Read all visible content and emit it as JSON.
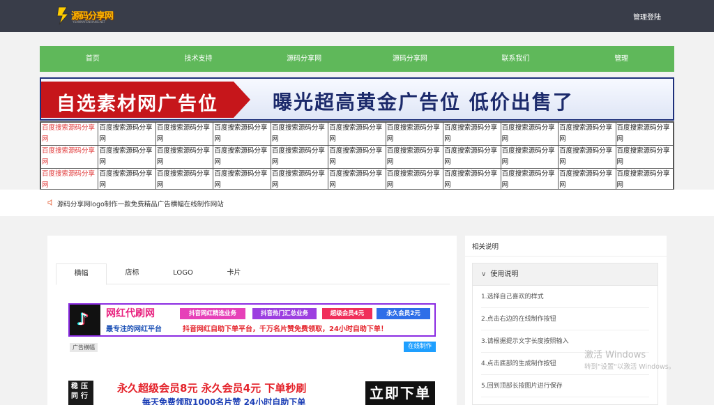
{
  "header": {
    "logo_text": "源码分享网",
    "logo_sub": "YUANMAFENXIANG.NET",
    "admin_login": "管理登陆"
  },
  "nav": [
    "首页",
    "技术支持",
    "源码分享网",
    "源码分享网",
    "联系我们",
    "管理"
  ],
  "banner": {
    "left_text": "自选素材网广告位",
    "right_text": "曝光超高黄金广告位 低价出售了"
  },
  "link_grid": {
    "rows": [
      [
        "百度搜索源码分享网",
        "百度搜索源码分享网",
        "百度搜索源码分享网",
        "百度搜索源码分享网",
        "百度搜索源码分享网",
        "百度搜索源码分享网",
        "百度搜索源码分享网",
        "百度搜索源码分享网",
        "百度搜索源码分享网",
        "百度搜索源码分享网",
        "百度搜索源码分享网"
      ],
      [
        "百度搜索源码分享网",
        "百度搜索源码分享网",
        "百度搜索源码分享网",
        "百度搜索源码分享网",
        "百度搜索源码分享网",
        "百度搜索源码分享网",
        "百度搜索源码分享网",
        "百度搜索源码分享网",
        "百度搜索源码分享网",
        "百度搜索源码分享网",
        "百度搜索源码分享网"
      ],
      [
        "百度搜索源码分享网",
        "百度搜索源码分享网",
        "百度搜索源码分享网",
        "百度搜索源码分享网",
        "百度搜索源码分享网",
        "百度搜索源码分享网",
        "百度搜索源码分享网",
        "百度搜索源码分享网",
        "百度搜索源码分享网",
        "百度搜索源码分享网",
        "百度搜索源码分享网"
      ]
    ]
  },
  "notice": "源码分享网logo制作一款免费精品广告横幅在线制作网站",
  "tabs": [
    "横幅",
    "店标",
    "LOGO",
    "卡片"
  ],
  "ad1": {
    "tiktok_glyph": "♪",
    "title": "网红代刷网",
    "pills": [
      "抖音网红精选业务",
      "抖音热门汇总业务",
      "超级会员4元",
      "永久会员2元"
    ],
    "slogan": "最专注的网红平台",
    "desc": "抖音网红自助下单平台，千万名片赞免费领取，24小时自助下单！"
  },
  "ad_tag": "广告横幅",
  "make_button": "在线制作",
  "ad2": {
    "side": "稳压同行",
    "title": "永久超级会员8元  永久会员4元  下单秒刷",
    "sub": "每天免费领取1000名片赞  24小时自助下单",
    "buy": "立即下单"
  },
  "sidebar": {
    "title": "相关说明",
    "section": "使用说明",
    "steps": [
      "1.选择自己喜欢的样式",
      "2.点击右边的在线制作按钮",
      "3.请根据提示文字长度按照输入",
      "4.点击底部的生成制作按钮",
      "5.回到顶部长按图片进行保存"
    ]
  },
  "watermark": {
    "line1": "激活 Windows",
    "line2": "转到\"设置\"以激活 Windows。"
  },
  "colors": {
    "topbar": "#393d49",
    "nav": "#5fb85a",
    "link_red": "#e03a3a",
    "button_blue": "#1e9fff"
  }
}
